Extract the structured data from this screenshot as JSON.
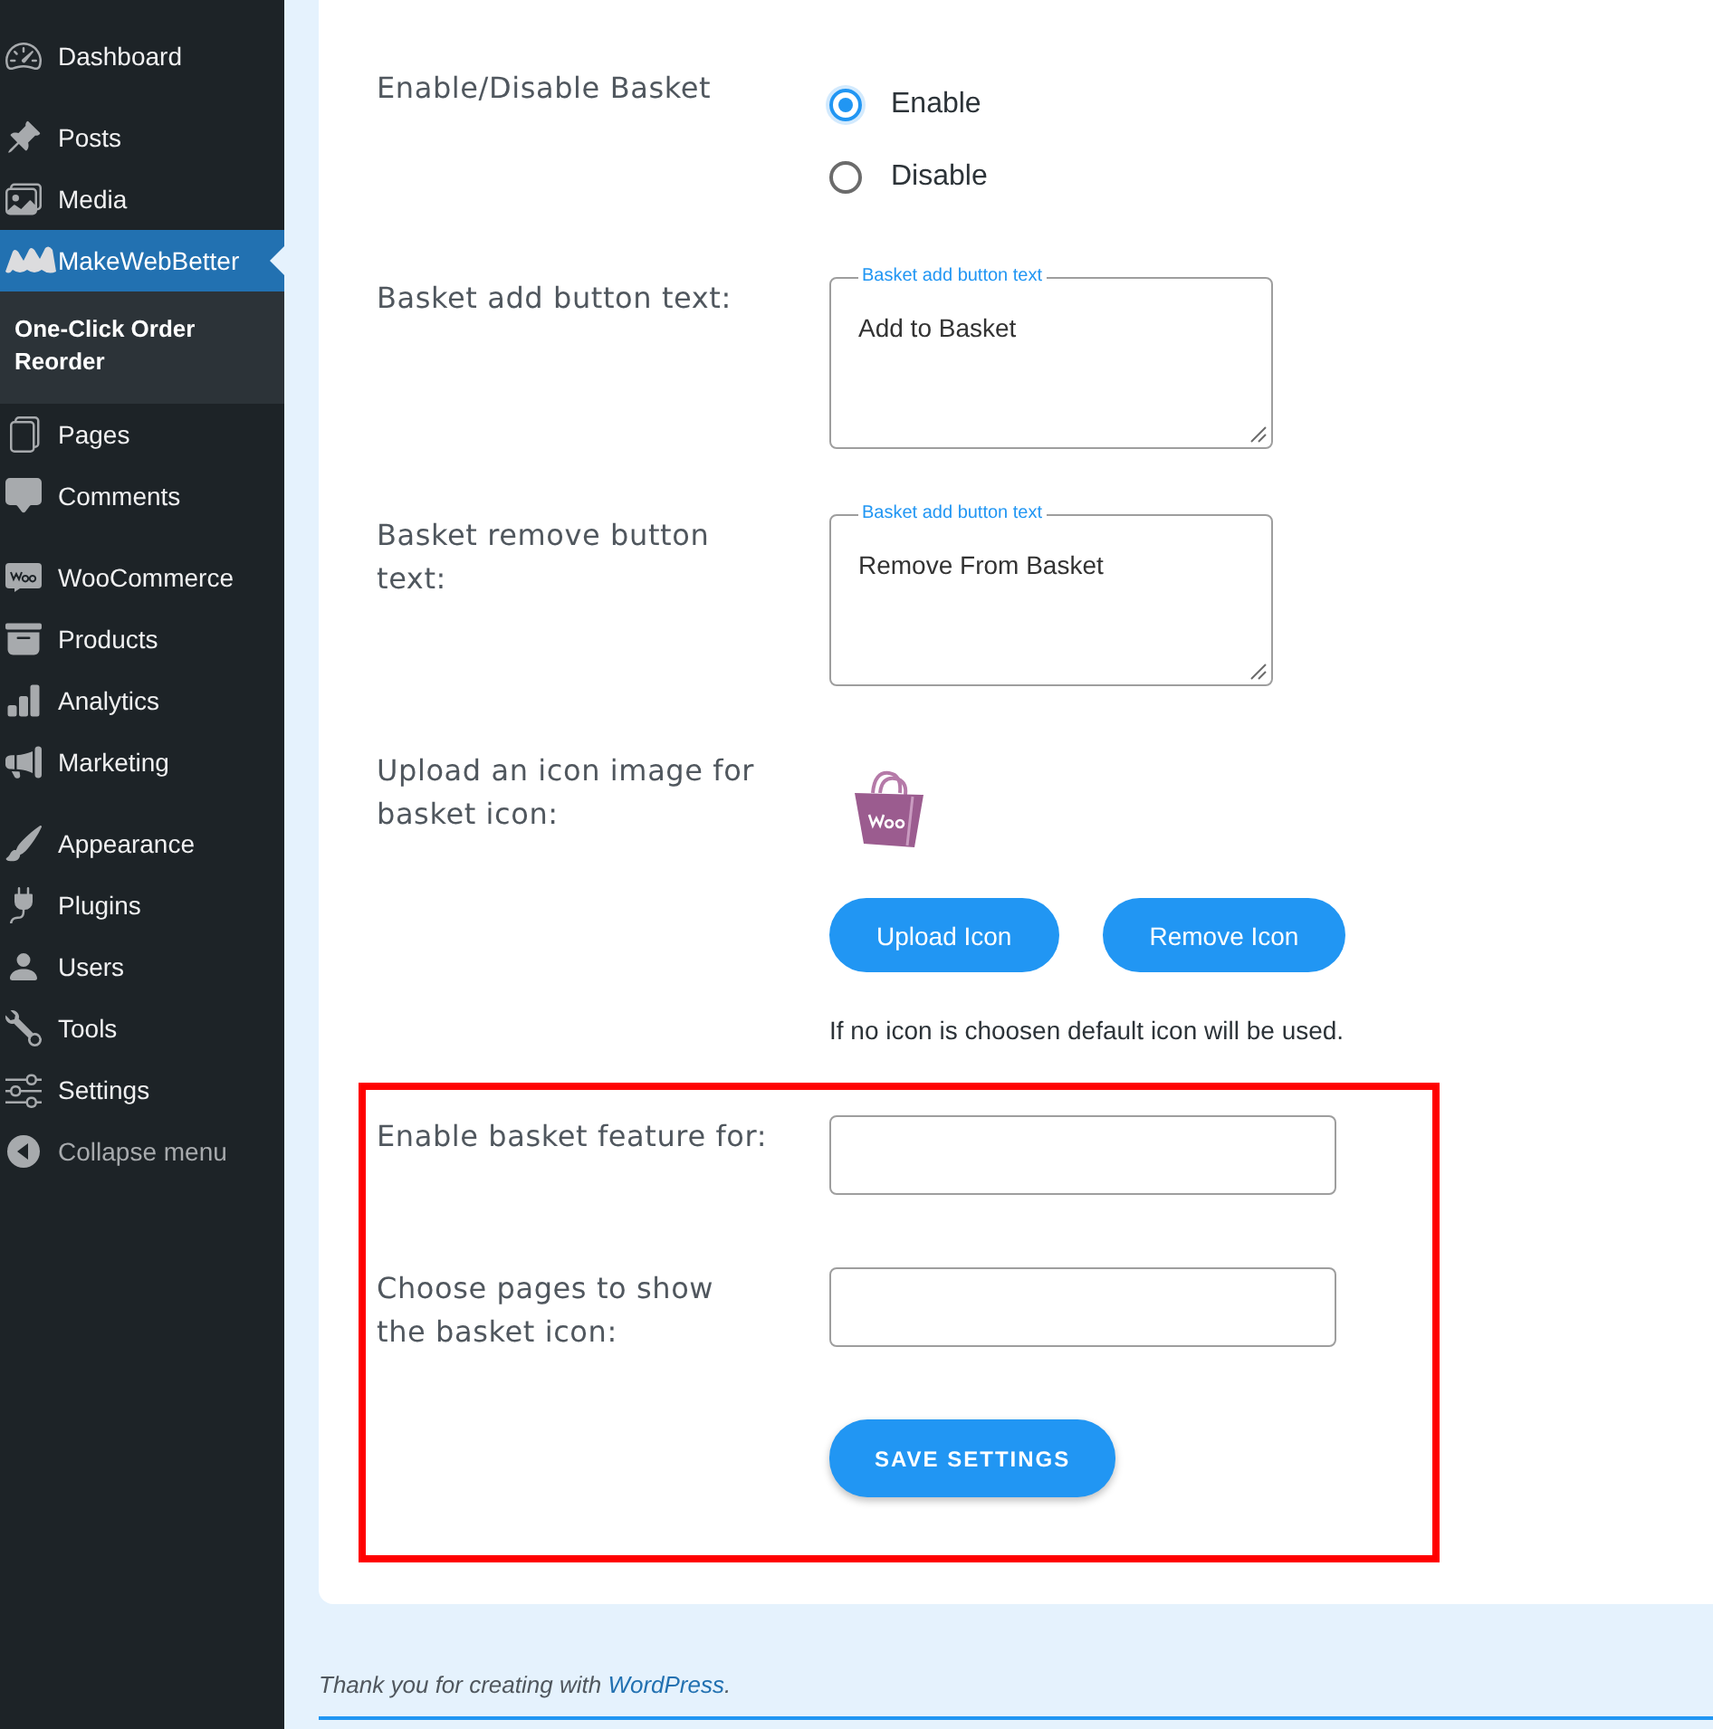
{
  "sidebar": {
    "groups": [
      {
        "items": [
          {
            "label": "Dashboard",
            "selected": false
          }
        ]
      },
      {
        "items": [
          {
            "label": "Posts",
            "selected": false
          },
          {
            "label": "Media",
            "selected": false
          },
          {
            "label": "MakeWebBetter",
            "selected": true,
            "submenu": [
              {
                "label": "One-Click Order Reorder",
                "selected": true
              }
            ]
          },
          {
            "label": "Pages",
            "selected": false
          },
          {
            "label": "Comments",
            "selected": false
          }
        ]
      },
      {
        "items": [
          {
            "label": "WooCommerce",
            "selected": false
          },
          {
            "label": "Products",
            "selected": false
          },
          {
            "label": "Analytics",
            "selected": false
          },
          {
            "label": "Marketing",
            "selected": false
          }
        ]
      },
      {
        "items": [
          {
            "label": "Appearance",
            "selected": false
          },
          {
            "label": "Plugins",
            "selected": false
          },
          {
            "label": "Users",
            "selected": false
          },
          {
            "label": "Tools",
            "selected": false
          },
          {
            "label": "Settings",
            "selected": false
          }
        ]
      }
    ],
    "collapse_label": "Collapse menu"
  },
  "form": {
    "rows": [
      {
        "kind": "radio",
        "label": "Enable/Disable Basket",
        "options": [
          {
            "label": "Enable",
            "selected": true
          },
          {
            "label": "Disable",
            "selected": false
          }
        ]
      },
      {
        "kind": "textarea",
        "label": "Basket add button text:",
        "field_label": "Basket add button text",
        "value": "Add to Basket"
      },
      {
        "kind": "textarea",
        "label": "Basket remove button text:",
        "field_label": "Basket add button text",
        "value": "Remove From Basket"
      },
      {
        "kind": "upload",
        "label": "Upload an icon image for basket icon:",
        "buttons": [
          "Upload Icon",
          "Remove Icon"
        ],
        "note": "If no icon is choosen default icon will be used."
      }
    ],
    "highlighted_section": {
      "rows": [
        {
          "kind": "input",
          "label": "Enable basket feature for:"
        },
        {
          "kind": "input",
          "label": "Choose pages to show the basket icon:"
        }
      ],
      "save_button": "SAVE SETTINGS"
    }
  },
  "footer": {
    "text": "Thank you for creating with",
    "link": "WordPress",
    "after": "."
  }
}
